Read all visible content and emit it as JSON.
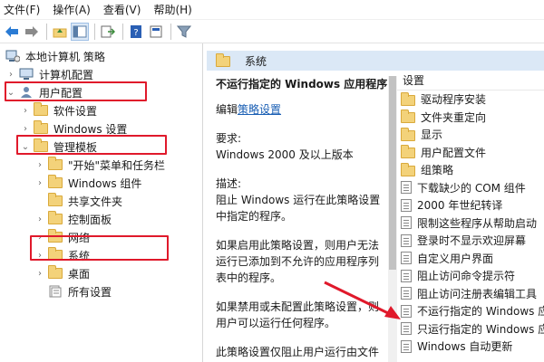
{
  "menubar": {
    "items": [
      "文件(F)",
      "操作(A)",
      "查看(V)",
      "帮助(H)"
    ]
  },
  "toolbar": {
    "icons": [
      "back-arrow-icon",
      "forward-arrow-icon",
      "up-folder-icon",
      "show-tree-icon",
      "export-list-icon",
      "help-icon",
      "properties-icon",
      "filter-icon"
    ]
  },
  "tree": {
    "root": "本地计算机 策略",
    "computer_config": "计算机配置",
    "user_config": "用户配置",
    "software_settings": "软件设置",
    "windows_settings": "Windows 设置",
    "admin_templates": "管理模板",
    "start_menu": "\"开始\"菜单和任务栏",
    "windows_components": "Windows 组件",
    "shared_folders": "共享文件夹",
    "control_panel": "控制面板",
    "network": "网络",
    "system": "系统",
    "desktop": "桌面",
    "all_settings": "所有设置"
  },
  "header": {
    "title": "系统"
  },
  "description": {
    "title": "不运行指定的 Windows 应用程序",
    "edit_prefix": "编辑",
    "edit_link": "策略设置",
    "requirement_label": "要求:",
    "requirement_value": "Windows 2000 及以上版本",
    "desc_label": "描述:",
    "desc_text": "阻止 Windows 运行在此策略设置中指定的程序。",
    "enabled_text": "如果启用此策略设置，则用户无法运行已添加到不允许的应用程序列表中的程序。",
    "disabled_text": "如果禁用或未配置此策略设置，则用户可以运行任何程序。",
    "more_text": "此策略设置仅阻止用户运行由文件"
  },
  "list": {
    "header": "设置",
    "items": [
      {
        "type": "folder",
        "label": "驱动程序安装"
      },
      {
        "type": "folder",
        "label": "文件夹重定向"
      },
      {
        "type": "folder",
        "label": "显示"
      },
      {
        "type": "folder",
        "label": "用户配置文件"
      },
      {
        "type": "folder",
        "label": "组策略"
      },
      {
        "type": "policy",
        "label": "下载缺少的 COM 组件"
      },
      {
        "type": "policy",
        "label": "2000 年世纪转译"
      },
      {
        "type": "policy",
        "label": "限制这些程序从帮助启动"
      },
      {
        "type": "policy",
        "label": "登录时不显示欢迎屏幕"
      },
      {
        "type": "policy",
        "label": "自定义用户界面"
      },
      {
        "type": "policy",
        "label": "阻止访问命令提示符"
      },
      {
        "type": "policy",
        "label": "阻止访问注册表编辑工具"
      },
      {
        "type": "policy",
        "label": "不运行指定的 Windows 应用程序"
      },
      {
        "type": "policy",
        "label": "只运行指定的 Windows 应用程序"
      },
      {
        "type": "policy",
        "label": "Windows 自动更新"
      }
    ]
  },
  "colors": {
    "highlight_red": "#e0192b",
    "header_band": "#dbe8f6",
    "link_blue": "#1a5fb4",
    "folder_yellow": "#f3d27a"
  }
}
